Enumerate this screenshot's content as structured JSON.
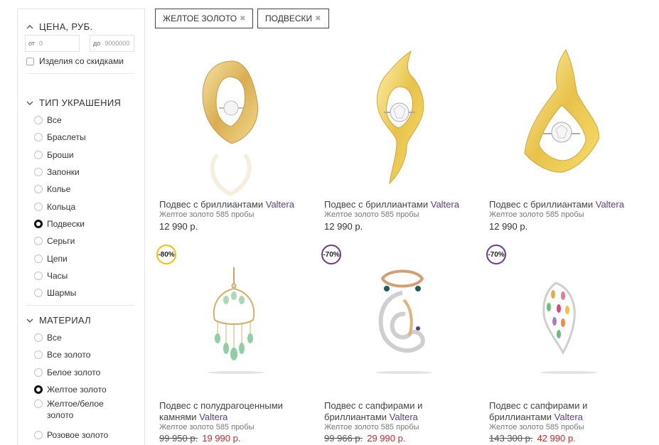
{
  "filters": {
    "price": {
      "title": "ЦЕНА, РУБ.",
      "from_label": "от",
      "from_placeholder": "0",
      "to_label": "до",
      "to_placeholder": "9000000",
      "discount_label": "Изделия со скидками"
    },
    "type": {
      "title": "ТИП УКРАШЕНИЯ",
      "items": [
        {
          "label": "Все",
          "selected": false
        },
        {
          "label": "Браслеты",
          "selected": false
        },
        {
          "label": "Броши",
          "selected": false
        },
        {
          "label": "Запонки",
          "selected": false
        },
        {
          "label": "Колье",
          "selected": false
        },
        {
          "label": "Кольца",
          "selected": false
        },
        {
          "label": "Подвески",
          "selected": true
        },
        {
          "label": "Серьги",
          "selected": false
        },
        {
          "label": "Цепи",
          "selected": false
        },
        {
          "label": "Часы",
          "selected": false
        },
        {
          "label": "Шармы",
          "selected": false
        }
      ]
    },
    "material": {
      "title": "МАТЕРИАЛ",
      "items": [
        {
          "label": "Все",
          "selected": false
        },
        {
          "label": "Все золото",
          "selected": false
        },
        {
          "label": "Белое золото",
          "selected": false
        },
        {
          "label": "Желтое золото",
          "selected": true
        },
        {
          "label": "Желтое/белое золото",
          "selected": false
        },
        {
          "label": "Розовое золото",
          "selected": false
        }
      ]
    }
  },
  "active_chips": [
    {
      "label": "ЖЕЛТОЕ ЗОЛОТО",
      "remove": "✖"
    },
    {
      "label": "ПОДВЕСКИ",
      "remove": "✖"
    }
  ],
  "products": [
    {
      "title": "Подвес с бриллиантами",
      "brand": "Valtera",
      "meta": "Желтое золото 585 пробы",
      "price": "12 990 р.",
      "old_price": "",
      "badge": ""
    },
    {
      "title": "Подвес с бриллиантами",
      "brand": "Valtera",
      "meta": "Желтое золото 585 пробы",
      "price": "12 990 р.",
      "old_price": "",
      "badge": ""
    },
    {
      "title": "Подвес с бриллиантами",
      "brand": "Valtera",
      "meta": "Желтое золото 585 пробы",
      "price": "12 990 р.",
      "old_price": "",
      "badge": ""
    },
    {
      "title": "Подвес с полудрагоценными камнями",
      "brand": "Valtera",
      "meta": "Желтое золото 585 пробы",
      "price": "19 990 р.",
      "old_price": "99 950 р.",
      "badge": "-80%"
    },
    {
      "title": "Подвес с сапфирами и бриллиантами",
      "brand": "Valtera",
      "meta": "Желтое золото 585 пробы",
      "price": "29 990 р.",
      "old_price": "99 966 р.",
      "badge": "-70%"
    },
    {
      "title": "Подвес с сапфирами и бриллиантами",
      "brand": "Valtera",
      "meta": "Желтое золото 585 пробы",
      "price": "42 990 р.",
      "old_price": "143 300 р.",
      "badge": "-70%"
    }
  ],
  "colors": {
    "brand_purple": "#5a3f86",
    "sale_red": "#d02727",
    "badge_yellow": "#f2c200",
    "badge_purple": "#6a3b8c",
    "gold": "#e8c24a"
  },
  "icons": {
    "section_toggle": "chevron-up-icon",
    "chip_remove": "close-icon"
  }
}
